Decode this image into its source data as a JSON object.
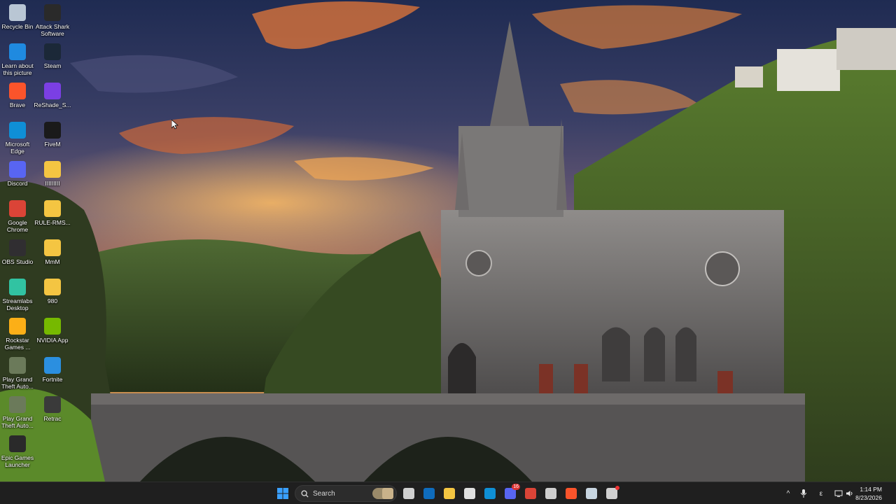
{
  "desktop": {
    "icons": [
      {
        "label": "Recycle Bin",
        "icon": "recycle-bin-icon",
        "color": "#b9c6d4"
      },
      {
        "label": "Attack Shark Software",
        "icon": "attack-shark-icon",
        "color": "#2a2a2a"
      },
      {
        "label": "Learn about this picture",
        "icon": "learn-about-picture-icon",
        "color": "#1f8ae0"
      },
      {
        "label": "Steam",
        "icon": "steam-icon",
        "color": "#1b2838"
      },
      {
        "label": "Brave",
        "icon": "brave-icon",
        "color": "#fb542b"
      },
      {
        "label": "ReShade_S...",
        "icon": "reshade-icon",
        "color": "#7b3fe4"
      },
      {
        "label": "Microsoft Edge",
        "icon": "edge-icon",
        "color": "#0f8fd6"
      },
      {
        "label": "FiveM",
        "icon": "fivem-icon",
        "color": "#1a1a1a"
      },
      {
        "label": "Discord",
        "icon": "discord-icon",
        "color": "#5865f2"
      },
      {
        "label": "IIIIIIIII",
        "icon": "folder-icon",
        "color": "#f4c542"
      },
      {
        "label": "Google Chrome",
        "icon": "chrome-icon",
        "color": "#db4437"
      },
      {
        "label": "RULE-RMS...",
        "icon": "folder-icon",
        "color": "#f4c542"
      },
      {
        "label": "OBS Studio",
        "icon": "obs-icon",
        "color": "#302e31"
      },
      {
        "label": "MmM",
        "icon": "folder-icon",
        "color": "#f4c542"
      },
      {
        "label": "Streamlabs Desktop",
        "icon": "streamlabs-icon",
        "color": "#31c3a2"
      },
      {
        "label": "980",
        "icon": "folder-icon",
        "color": "#f4c542"
      },
      {
        "label": "Rockstar Games ...",
        "icon": "rockstar-icon",
        "color": "#fcaf17"
      },
      {
        "label": "NVIDIA App",
        "icon": "nvidia-icon",
        "color": "#76b900"
      },
      {
        "label": "Play Grand Theft Auto...",
        "icon": "gta-icon",
        "color": "#6b7a5a"
      },
      {
        "label": "Fortnite",
        "icon": "fortnite-icon",
        "color": "#2b8fe0"
      },
      {
        "label": "Play Grand Theft Auto...",
        "icon": "gta-icon",
        "color": "#6b7a5a"
      },
      {
        "label": "Retrac",
        "icon": "retrac-icon",
        "color": "#3a3a3a"
      },
      {
        "label": "Epic Games Launcher",
        "icon": "epic-games-icon",
        "color": "#2a2a2a"
      }
    ]
  },
  "taskbar": {
    "search_label": "Search",
    "apps": [
      {
        "name": "start-button",
        "icon": "windows-logo-icon",
        "color": "#3aa0ff"
      },
      {
        "name": "widget-button",
        "icon": "widget-icon",
        "color": "#c9b28a"
      },
      {
        "name": "task-view-button",
        "icon": "task-view-icon",
        "color": "#d0d0d0"
      },
      {
        "name": "outlook-button",
        "icon": "outlook-icon",
        "color": "#0f6cbd"
      },
      {
        "name": "file-explorer-button",
        "icon": "folder-icon",
        "color": "#f4c542"
      },
      {
        "name": "microsoft-store-button",
        "icon": "store-icon",
        "color": "#e0e0e0"
      },
      {
        "name": "edge-button",
        "icon": "edge-icon",
        "color": "#0f8fd6"
      },
      {
        "name": "discord-button",
        "icon": "discord-icon",
        "color": "#5865f2",
        "badge": "16"
      },
      {
        "name": "chrome-button",
        "icon": "chrome-icon",
        "color": "#db4437"
      },
      {
        "name": "settings-button",
        "icon": "gear-icon",
        "color": "#cfcfcf"
      },
      {
        "name": "brave-button",
        "icon": "brave-icon",
        "color": "#fb542b"
      },
      {
        "name": "steam-button",
        "icon": "steam-icon",
        "color": "#c7d5e0"
      },
      {
        "name": "app-button",
        "icon": "app-icon",
        "color": "#d0d0d0",
        "badge_dot": true
      }
    ],
    "tray": {
      "chevron": "^",
      "keyboard_char": "ε"
    },
    "clock": {
      "time": "1:14 PM",
      "date": "8/23/2026"
    }
  }
}
